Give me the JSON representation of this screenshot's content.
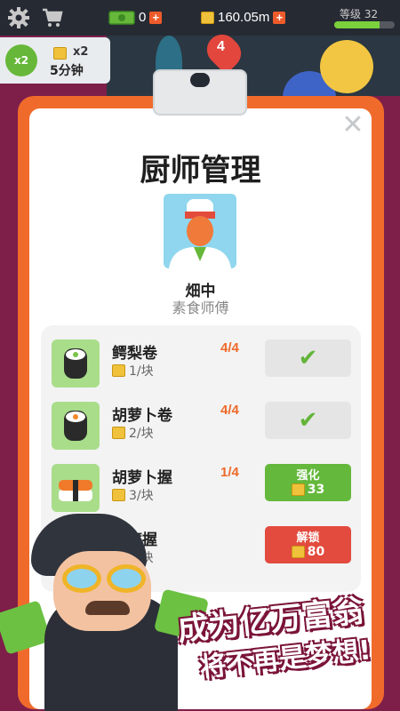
{
  "colors": {
    "background": "#7e1f4a",
    "clipboard_border": "#f06b2b",
    "accent_green": "#64b83b",
    "accent_red": "#e24b3d",
    "level_orange": "#ee6a2a"
  },
  "topbar": {
    "settings_icon": "gear-icon",
    "shop_icon": "shopping-cart-icon",
    "cash": {
      "icon": "cash-icon",
      "value": "0",
      "add_label": "+"
    },
    "gold": {
      "icon": "gold-bar-icon",
      "value": "160.05m",
      "add_label": "+"
    },
    "level": {
      "label": "等级 32",
      "progress": 0.75
    }
  },
  "boost": {
    "badge": "x2",
    "multiplier": "x2",
    "duration": "5分钟"
  },
  "map_pin": "4",
  "dialog": {
    "title": "厨师管理",
    "close_label": "✕",
    "chef": {
      "name": "畑中",
      "title": "素食师傅"
    },
    "dishes": [
      {
        "name": "鳄梨卷",
        "price": "1/块",
        "level": "4/4",
        "status": "done",
        "icon": "avocado-roll-icon"
      },
      {
        "name": "胡萝卜卷",
        "price": "2/块",
        "level": "4/4",
        "status": "done",
        "icon": "carrot-roll-icon"
      },
      {
        "name": "胡萝卜握",
        "price": "3/块",
        "level": "1/4",
        "status": "upgrade",
        "action_label": "强化",
        "action_cost": "33",
        "icon": "carrot-nigiri-icon"
      },
      {
        "name": "豆腐握",
        "price": "5/块",
        "level": "",
        "status": "unlock",
        "action_label": "解锁",
        "action_cost": "80",
        "icon": "tofu-nigiri-icon"
      }
    ]
  },
  "banner": {
    "line1": "成为亿万富翁",
    "line2": "将不再是梦想!"
  }
}
